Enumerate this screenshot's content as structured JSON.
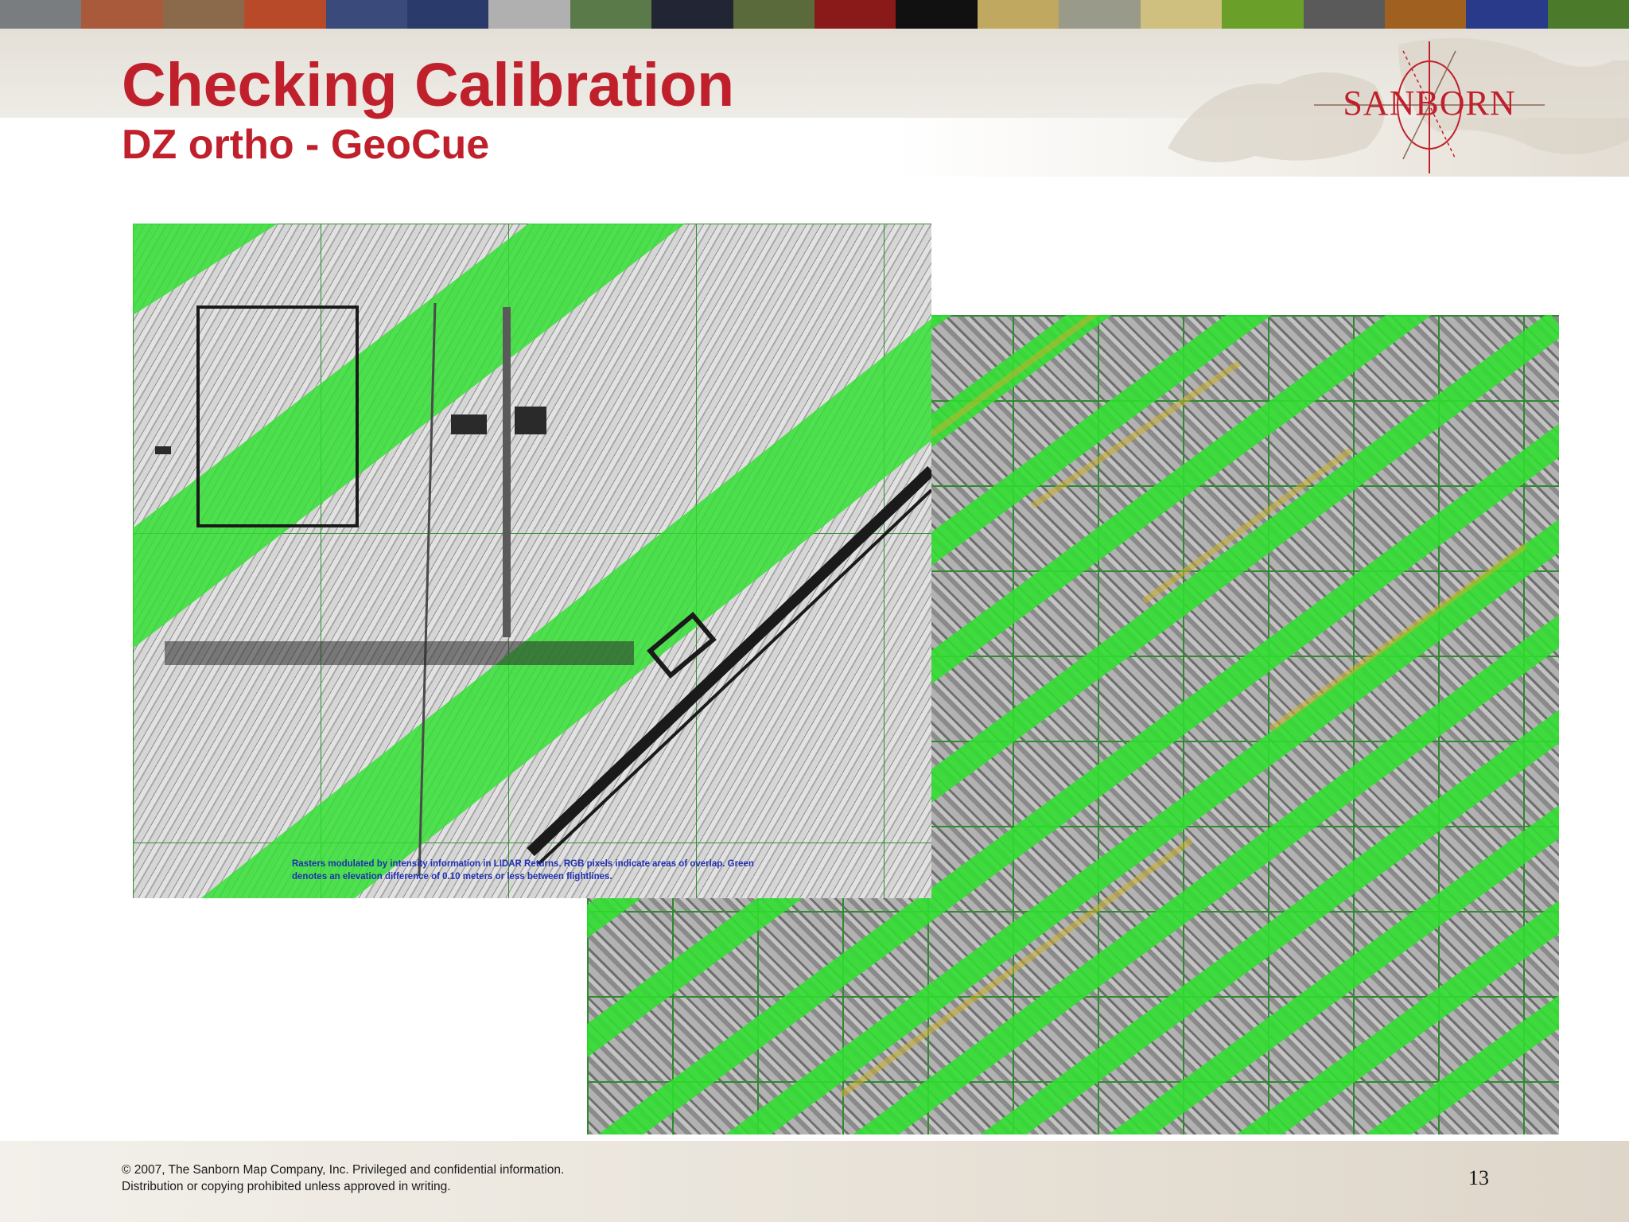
{
  "slide": {
    "title": "Checking Calibration",
    "subtitle": "DZ ortho - GeoCue",
    "page_number": "13"
  },
  "logo": {
    "text": "SANBORN"
  },
  "images": {
    "front_caption": "Rasters modulated by intensity information in LIDAR Returns. RGB pixels indicate areas of overlap. Green denotes an elevation difference of 0.10 meters or less between flightlines."
  },
  "footer": {
    "line1": "© 2007, The Sanborn Map Company, Inc. Privileged and confidential information.",
    "line2": "Distribution or copying prohibited unless approved in writing."
  },
  "colors": {
    "accent": "#c0202c",
    "overlap_green": "#2fe02f",
    "caption_blue": "#1f2fb0"
  }
}
